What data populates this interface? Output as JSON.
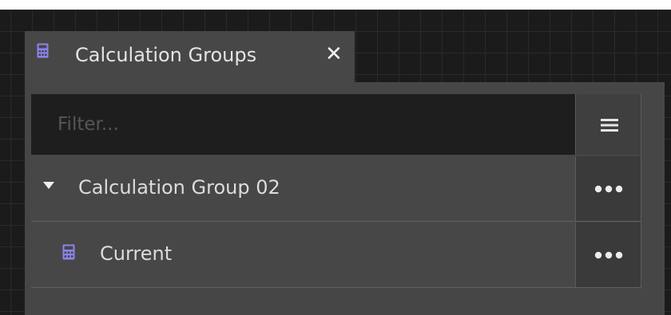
{
  "tab": {
    "title": "Calculation Groups",
    "close_symbol": "✕",
    "icon": "calculator-icon"
  },
  "filter": {
    "value": "",
    "placeholder": "Filter..."
  },
  "toolbar": {
    "menu_icon": "hamburger-menu-icon"
  },
  "tree": {
    "group": {
      "label": "Calculation Group 02",
      "expanded": true,
      "icon": "caret-down-icon",
      "more_icon": "more-horizontal-icon"
    },
    "items": [
      {
        "label": "Current",
        "icon": "calculator-icon",
        "more_icon": "more-horizontal-icon"
      }
    ]
  },
  "colors": {
    "background": "#1b1b1b",
    "panel": "#464646",
    "input": "#1e1e1e",
    "accent_icon": "#8b84f0",
    "text": "#dcdcdc"
  }
}
